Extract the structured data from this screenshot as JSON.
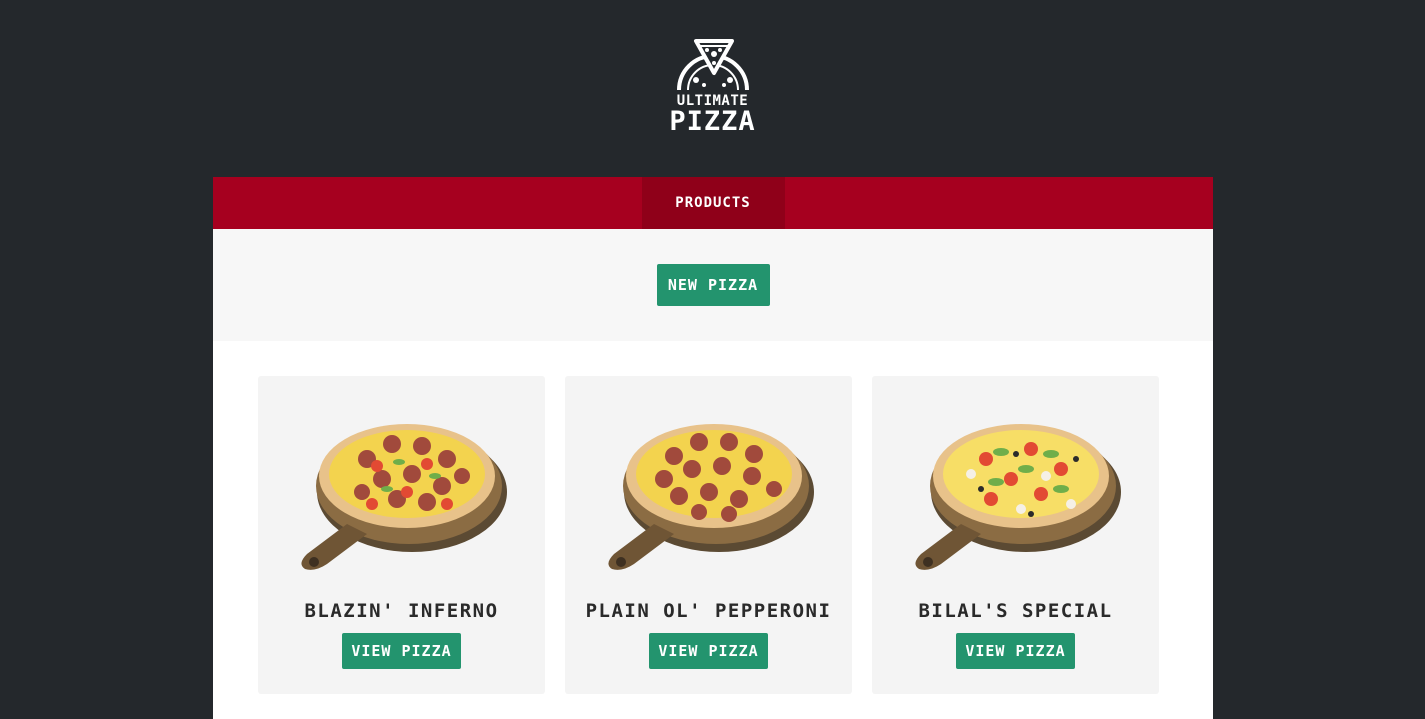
{
  "brand": {
    "line1": "ULTIMATE",
    "line2": "PIZZA"
  },
  "nav": {
    "tabs": [
      {
        "label": "PRODUCTS",
        "active": true
      }
    ]
  },
  "actions": {
    "new_button": "NEW PIZZA"
  },
  "colors": {
    "background": "#24282c",
    "nav": "#a6001f",
    "nav_active": "#8f0019",
    "button": "#23946e"
  },
  "products": [
    {
      "name": "BLAZIN' INFERNO",
      "button": "VIEW PIZZA",
      "image": "pizza-inferno"
    },
    {
      "name": "PLAIN OL' PEPPERONI",
      "button": "VIEW PIZZA",
      "image": "pizza-pepperoni"
    },
    {
      "name": "BILAL'S SPECIAL",
      "button": "VIEW PIZZA",
      "image": "pizza-special"
    }
  ]
}
